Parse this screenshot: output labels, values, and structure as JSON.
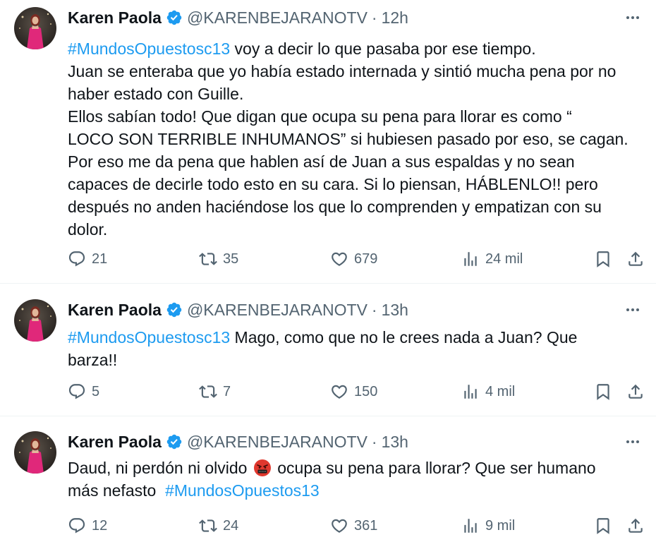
{
  "colors": {
    "text": "#0f1419",
    "secondary": "#536471",
    "link": "#1d9bf0",
    "verified": "#1d9bf0",
    "divider": "#eff3f4"
  },
  "tweets": [
    {
      "author": {
        "name": "Karen Paola",
        "handle": "@KARENBEJARANOTV",
        "verified_icon": "verified-badge-icon",
        "avatar": "avatar-photo"
      },
      "separator": "·",
      "time": "12h",
      "lines": [
        [
          {
            "t": "#MundosOpuestosc13",
            "h": true
          },
          {
            "t": " voy a decir lo que pasaba por ese tiempo."
          }
        ],
        [
          {
            "t": "Juan se enteraba que yo había estado internada y sintió mucha pena por no"
          }
        ],
        [
          {
            "t": "haber estado con Guille."
          }
        ],
        [
          {
            "t": "Ellos sabían todo! Que digan que ocupa su pena para llorar es como “"
          }
        ],
        [
          {
            "t": "LOCO SON TERRIBLE INHUMANOS” si hubiesen pasado por eso, se cagan."
          }
        ],
        [
          {
            "t": "Por eso me da pena que hablen así de Juan a sus espaldas y no sean"
          }
        ],
        [
          {
            "t": "capaces de decirle todo esto en su cara. Si lo piensan, HÁBLENLO!! pero"
          }
        ],
        [
          {
            "t": "después no anden haciéndose los que lo comprenden y empatizan con su"
          }
        ],
        [
          {
            "t": "dolor."
          }
        ]
      ],
      "metrics": {
        "replies": "21",
        "reposts": "35",
        "likes": "679",
        "views": "24 mil"
      }
    },
    {
      "author": {
        "name": "Karen Paola",
        "handle": "@KARENBEJARANOTV",
        "verified_icon": "verified-badge-icon",
        "avatar": "avatar-photo"
      },
      "separator": "·",
      "time": "13h",
      "lines": [
        [
          {
            "t": "#MundosOpuestosc13",
            "h": true
          },
          {
            "t": " Mago, como que no le crees nada a Juan? Que"
          }
        ],
        [
          {
            "t": "barza!!"
          }
        ]
      ],
      "metrics": {
        "replies": "5",
        "reposts": "7",
        "likes": "150",
        "views": "4 mil"
      }
    },
    {
      "author": {
        "name": "Karen Paola",
        "handle": "@KARENBEJARANOTV",
        "verified_icon": "verified-badge-icon",
        "avatar": "avatar-photo"
      },
      "separator": "·",
      "time": "13h",
      "lines": [
        [
          {
            "t": "Daud, ni perdón ni olvido "
          },
          {
            "emoji": "angry-swearing-face-emoji"
          },
          {
            "t": " ocupa su pena para llorar? Que ser humano"
          }
        ],
        [
          {
            "t": "más nefasto  "
          },
          {
            "t": "#MundosOpuestos13",
            "h": true
          }
        ]
      ],
      "metrics": {
        "replies": "12",
        "reposts": "24",
        "likes": "361",
        "views": "9 mil"
      }
    }
  ]
}
